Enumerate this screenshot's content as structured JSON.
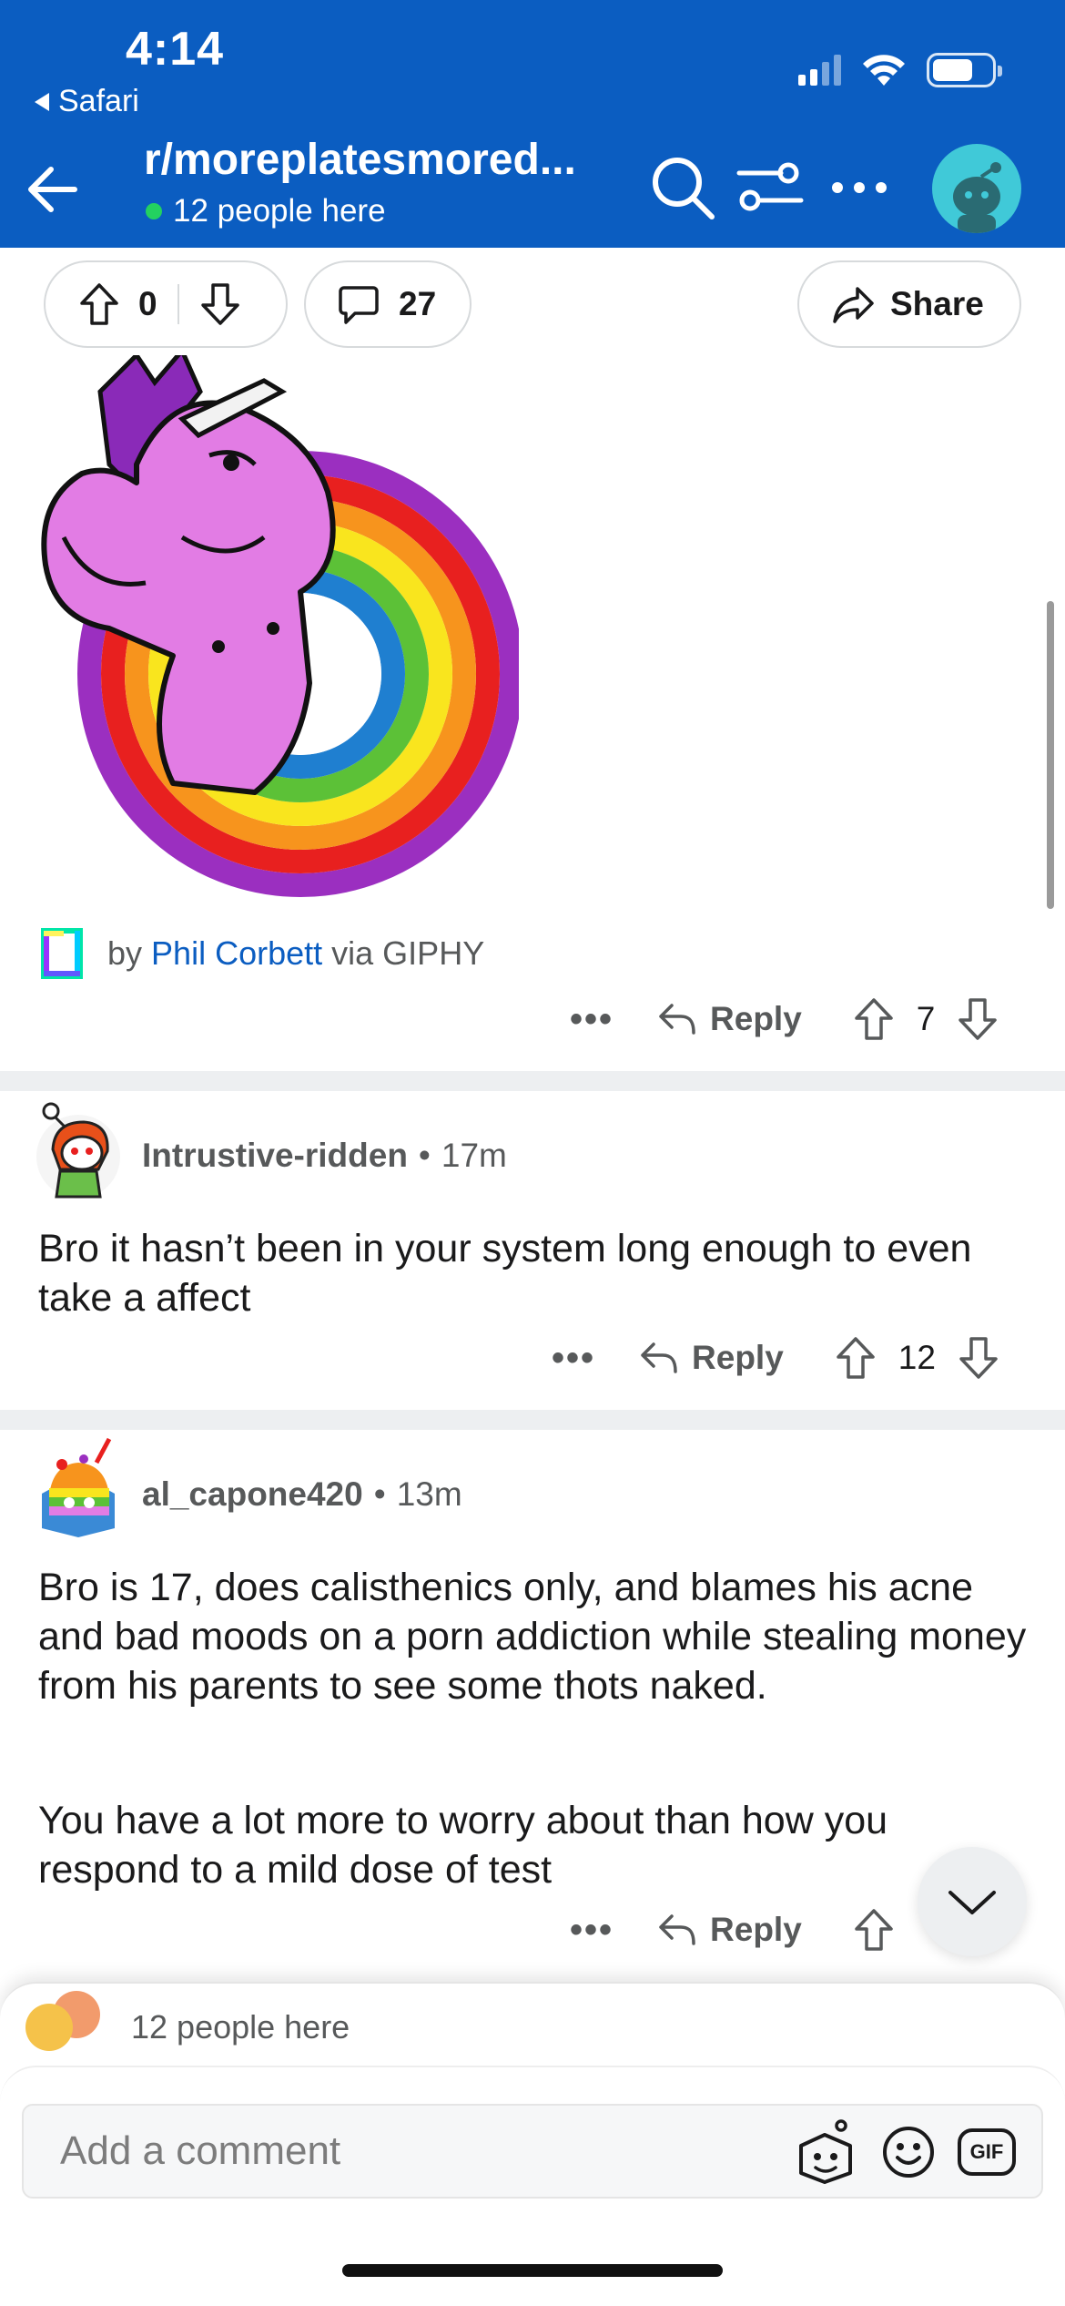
{
  "status_bar": {
    "time": "4:14",
    "back_app": "Safari"
  },
  "header": {
    "subreddit": "r/moreplatesmored...",
    "online": "12 people here"
  },
  "post_actions": {
    "score": "0",
    "comments": "27",
    "share_label": "Share"
  },
  "gif_attribution": {
    "by": "by",
    "author": "Phil Corbett",
    "via": "via GIPHY"
  },
  "comments": [
    {
      "reply_label": "Reply",
      "score": "7"
    },
    {
      "user": "Intrustive-ridden",
      "age": "17m",
      "body": "Bro it hasn’t been in your system long enough to even take a affect",
      "reply_label": "Reply",
      "score": "12"
    },
    {
      "user": "al_capone420",
      "age": "13m",
      "body_p1": "Bro is 17, does calisthenics only, and blames his acne and bad moods on a porn addiction while stealing money from his parents to see some thots naked.",
      "body_p2": "You have a lot more to worry about than how you respond to a mild dose of test",
      "reply_label": "Reply"
    }
  ],
  "bottom": {
    "presence": "12 people here",
    "compose_placeholder": "Add a comment",
    "gif_label": "GIF"
  },
  "colors": {
    "header_bg": "#0b5dc1",
    "link": "#0b5dc1",
    "online_dot": "#23d160"
  }
}
